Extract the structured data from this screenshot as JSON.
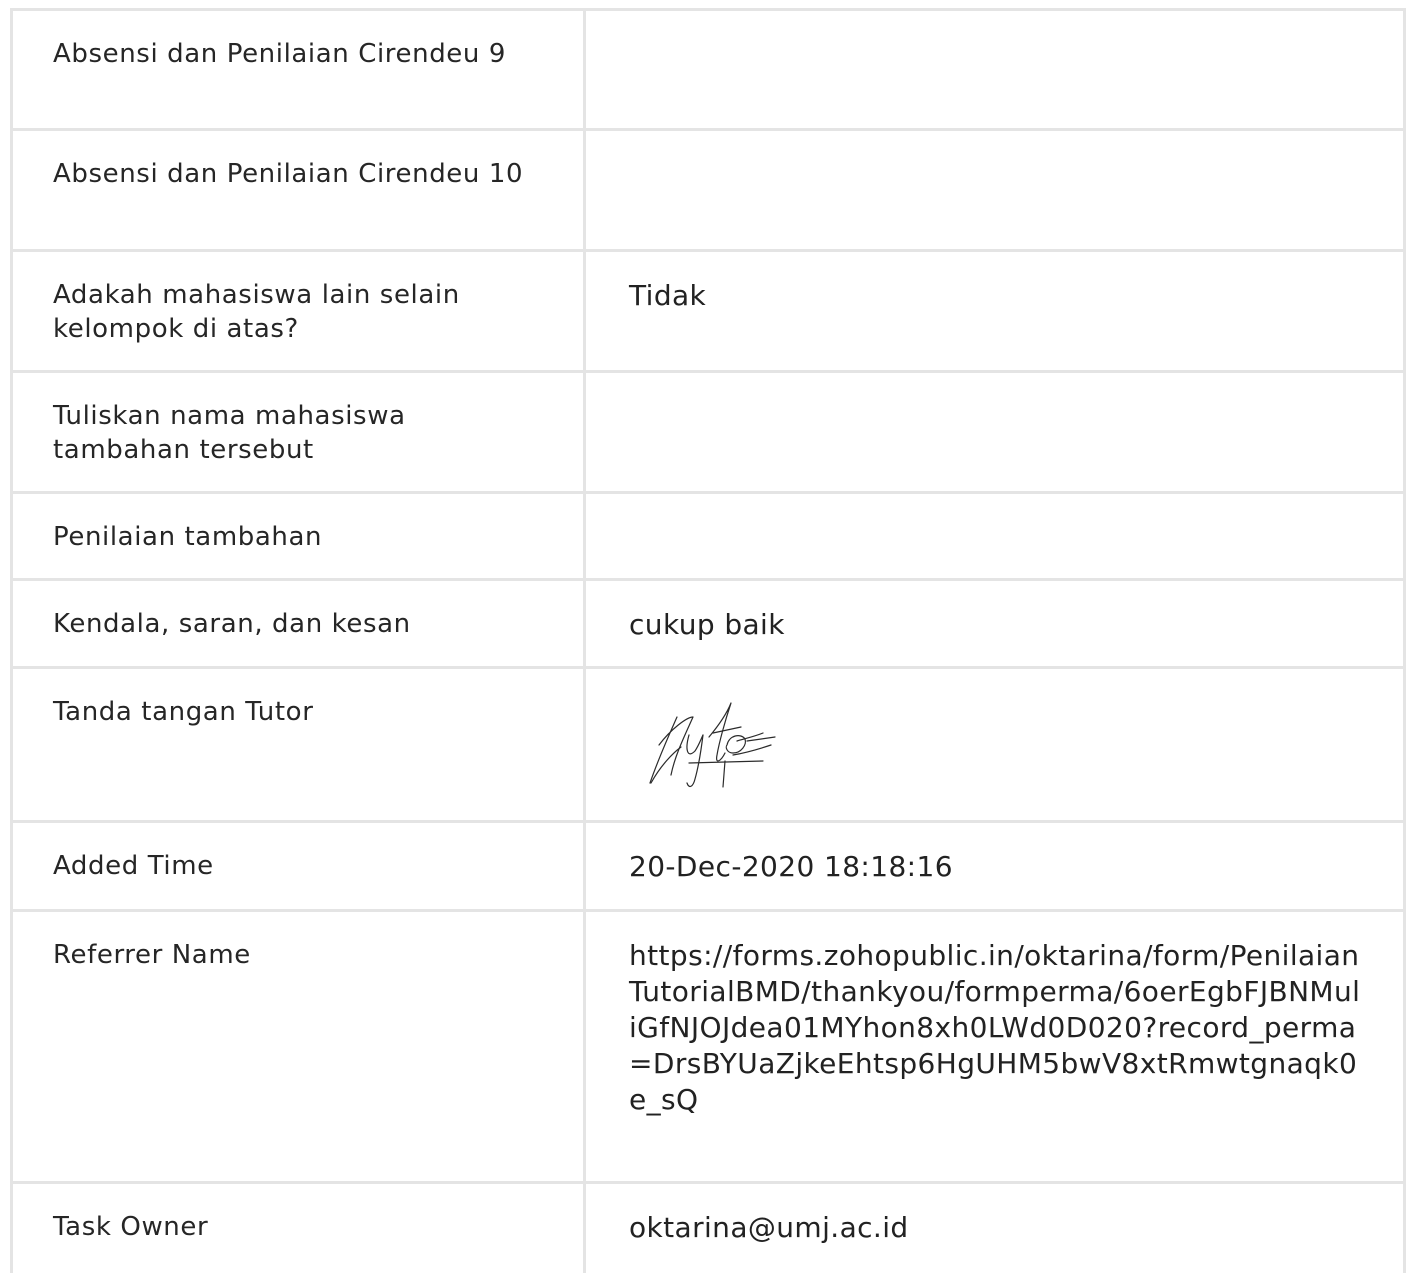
{
  "rows": [
    {
      "label": "Absensi dan Penilaian Cirendeu 9",
      "value": ""
    },
    {
      "label": "Absensi dan Penilaian Cirendeu 10",
      "value": ""
    },
    {
      "label": "Adakah mahasiswa lain selain kelompok di atas?",
      "value": "Tidak"
    },
    {
      "label": "Tuliskan nama mahasiswa tambahan tersebut",
      "value": ""
    },
    {
      "label": "Penilaian tambahan",
      "value": ""
    },
    {
      "label": "Kendala, saran, dan kesan",
      "value": "cukup baik"
    },
    {
      "label": "Tanda tangan Tutor",
      "value": ""
    },
    {
      "label": "Added Time",
      "value": "20-Dec-2020 18:18:16"
    },
    {
      "label": "Referrer Name",
      "value": "https://forms.zohopublic.in/oktarina/form/PenilaianTutorialBMD/thankyou/formperma/6oerEgbFJBNMuliGfNJOJdea01MYhon8xh0LWd0D020?record_perma=DrsBYUaZjkeEhtsp6HgUHM5bwV8xtRmwtgnaqk0e_sQ"
    },
    {
      "label": "Task Owner",
      "value": "oktarina@umj.ac.id"
    }
  ],
  "signature": {
    "type": "handwritten-signature"
  }
}
